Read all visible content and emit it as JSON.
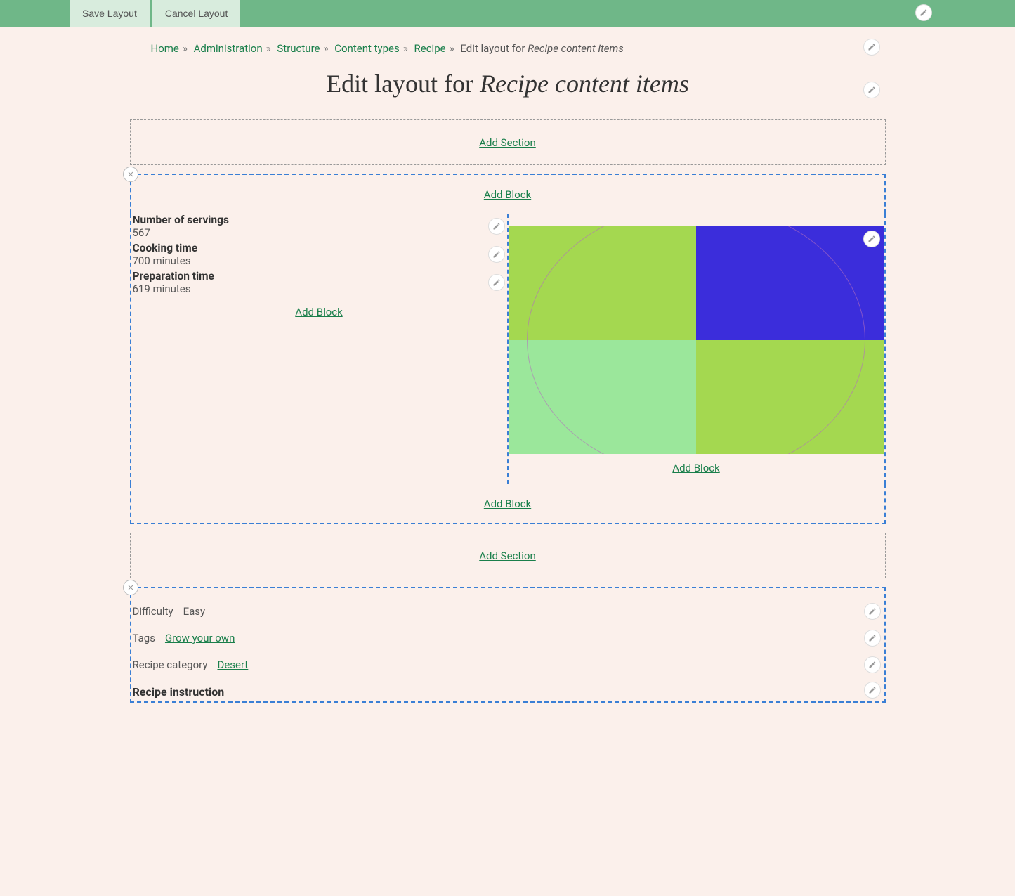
{
  "toolbar": {
    "save": "Save Layout",
    "cancel": "Cancel Layout"
  },
  "breadcrumb": {
    "home": "Home",
    "admin": "Administration",
    "structure": "Structure",
    "content_types": "Content types",
    "recipe": "Recipe",
    "current_prefix": "Edit layout for ",
    "current_italic": "Recipe content items"
  },
  "title": {
    "prefix": "Edit layout for ",
    "italic": "Recipe content items"
  },
  "actions": {
    "add_section": "Add Section",
    "add_block": "Add Block"
  },
  "section1": {
    "fields": [
      {
        "label": "Number of servings",
        "value": "567"
      },
      {
        "label": "Cooking time",
        "value": "700 minutes"
      },
      {
        "label": "Preparation time",
        "value": "619 minutes"
      }
    ]
  },
  "section2": {
    "difficulty": {
      "label": "Difficulty",
      "value": "Easy"
    },
    "tags": {
      "label": "Tags",
      "value": "Grow your own"
    },
    "category": {
      "label": "Recipe category",
      "value": "Desert"
    },
    "instruction": {
      "label": "Recipe instruction"
    }
  }
}
